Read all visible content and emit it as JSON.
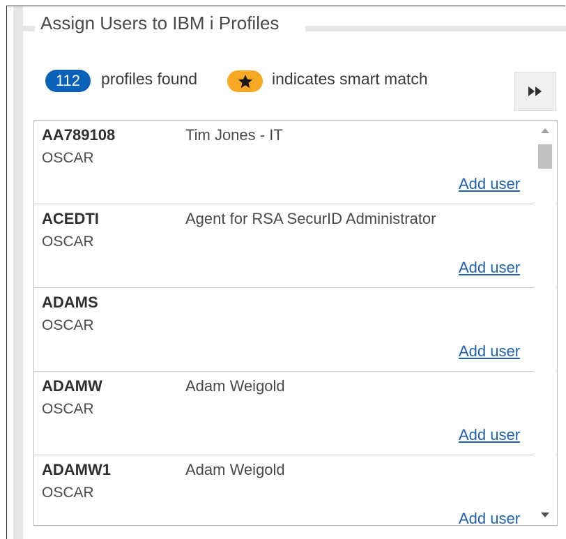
{
  "panel": {
    "title": "Assign Users to IBM i Profiles"
  },
  "summary": {
    "count": "112",
    "count_label": "profiles found",
    "smart_match_label": "indicates smart match",
    "star_icon": "star-icon"
  },
  "colors": {
    "count_pill": "#0a62b8",
    "smart_match_pill": "#f7a823",
    "link": "#1f62b0"
  },
  "expand_button": {
    "icon": "double-chevron-right-icon"
  },
  "profiles": [
    {
      "id": "AA789108",
      "system": "OSCAR",
      "description": "Tim Jones - IT",
      "action": "Add user"
    },
    {
      "id": "ACEDTI",
      "system": "OSCAR",
      "description": "Agent for RSA SecurID Administrator",
      "action": "Add user"
    },
    {
      "id": "ADAMS",
      "system": "OSCAR",
      "description": "",
      "action": "Add user"
    },
    {
      "id": "ADAMW",
      "system": "OSCAR",
      "description": "Adam Weigold",
      "action": "Add user"
    },
    {
      "id": "ADAMW1",
      "system": "OSCAR",
      "description": "Adam Weigold",
      "action": "Add user"
    }
  ]
}
